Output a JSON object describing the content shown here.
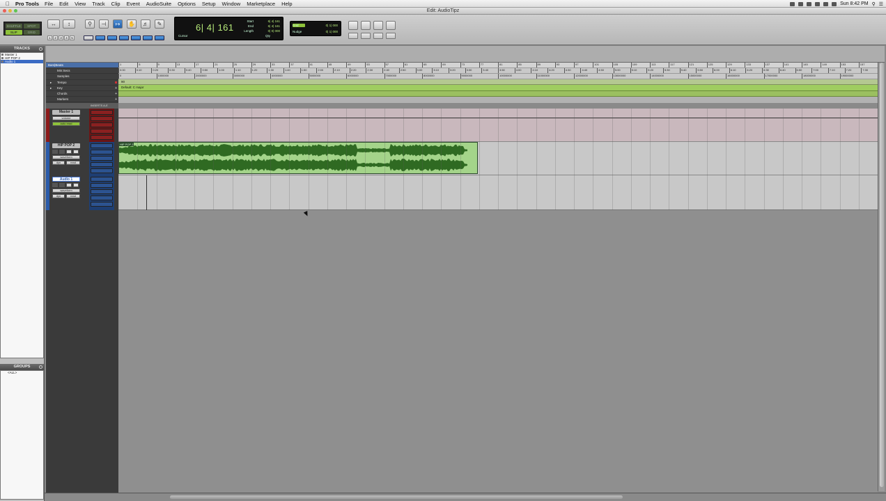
{
  "menubar": {
    "app_name": "Pro Tools",
    "items": [
      "File",
      "Edit",
      "View",
      "Track",
      "Clip",
      "Event",
      "AudioSuite",
      "Options",
      "Setup",
      "Window",
      "Marketplace",
      "Help"
    ],
    "clock": "Sun 8:42 PM"
  },
  "window": {
    "title": "Edit: AudioTipz"
  },
  "toolbar": {
    "modes": [
      "SHUFFLE",
      "SPOT",
      "SLIP",
      "GRID"
    ],
    "zoom_presets": [
      "1",
      "2",
      "3",
      "4",
      "5"
    ],
    "counter": {
      "main": "6| 4| 161",
      "start_label": "Start",
      "end_label": "End",
      "length_label": "Length",
      "start_value": "6| 4| 161",
      "end_value": "6| 4| 161",
      "length_value": "0| 0| 000",
      "cursor_label": "Cursor",
      "qty_label": "Qty"
    },
    "grid": {
      "grid_label": "Grid",
      "grid_value": "0| 1| 000",
      "nudge_label": "Nudge",
      "nudge_value": "0| 1| 000"
    }
  },
  "panels": {
    "tracks_title": "TRACKS",
    "tracks": [
      "Master 1",
      "HIP POP 2",
      "Audio 1"
    ],
    "selected_track": "Audio 1",
    "groups_title": "GROUPS",
    "groups": [
      "<ALL>"
    ]
  },
  "rulers": {
    "labels": [
      "Bars|Beats",
      "Min:Secs",
      "Samples",
      "Tempo",
      "Key",
      "Chords",
      "Markers"
    ],
    "bars": [
      "1",
      "5",
      "9",
      "13",
      "17",
      "21",
      "25",
      "29",
      "33",
      "37",
      "41",
      "45",
      "49",
      "53",
      "57",
      "61",
      "65",
      "69",
      "73",
      "77",
      "81",
      "85",
      "89",
      "93",
      "97",
      "101",
      "105",
      "109",
      "113",
      "117",
      "121",
      "125",
      "129",
      "133",
      "137",
      "141",
      "145",
      "149",
      "153",
      "157"
    ],
    "minsecs": [
      "0:00",
      "0:10",
      "0:20",
      "0:30",
      "0:40",
      "0:50",
      "1:00",
      "1:10",
      "1:20",
      "1:30",
      "1:40",
      "1:50",
      "2:00",
      "2:10",
      "2:20",
      "2:30",
      "2:40",
      "2:50",
      "3:00",
      "3:10",
      "3:20",
      "3:30",
      "3:40",
      "3:50",
      "4:00",
      "4:10",
      "4:20",
      "4:30",
      "4:40",
      "4:50",
      "5:00",
      "5:10",
      "5:20",
      "5:30",
      "5:40",
      "5:50",
      "6:00",
      "6:10",
      "6:20",
      "6:30",
      "6:40",
      "6:50",
      "7:00",
      "7:10",
      "7:20",
      "7:30"
    ],
    "samples": [
      "0",
      "1000000",
      "2000000",
      "3000000",
      "4000000",
      "5000000",
      "6000000",
      "7000000",
      "8000000",
      "9000000",
      "10000000",
      "11000000",
      "12000000",
      "13000000",
      "14000000",
      "15000000",
      "16000000",
      "17000000",
      "18000000",
      "19000000"
    ],
    "tempo_value": "90",
    "key_value": "Default: C major"
  },
  "tracks": [
    {
      "name": "Master 1",
      "color": "#8b1a1a",
      "controls": [
        "volume",
        "auto read"
      ]
    },
    {
      "name": "HIP POP 2",
      "color": "#2a5aa8",
      "controls": [
        "waveform",
        "dyn",
        "read"
      ]
    },
    {
      "name": "Audio 1",
      "color": "#2a5aa8",
      "controls": [
        "waveform",
        "dyn",
        "read"
      ]
    }
  ],
  "io_header": "INSERTS A-E",
  "clip": {
    "name": "HIP POP 2",
    "color": "#a4d48a",
    "waveform_color": "#2f6a22"
  }
}
